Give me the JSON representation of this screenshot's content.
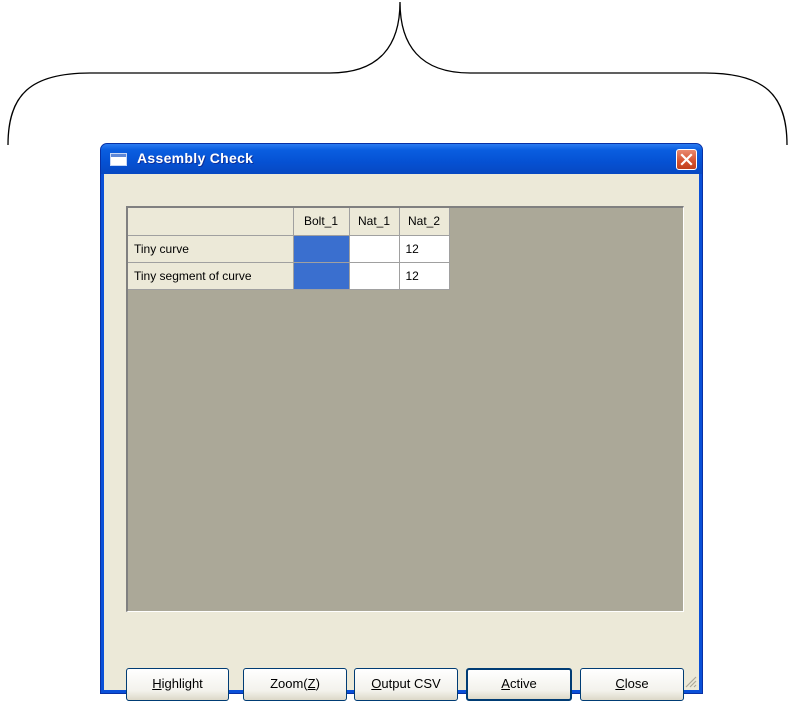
{
  "window": {
    "title": "Assembly Check"
  },
  "grid": {
    "columns": [
      "Bolt_1",
      "Nat_1",
      "Nat_2"
    ],
    "rows": [
      {
        "label": "Tiny curve",
        "cells": [
          "",
          "",
          "12"
        ],
        "bolt_highlighted": true
      },
      {
        "label": "Tiny segment of curve",
        "cells": [
          "",
          "",
          "12"
        ],
        "bolt_highlighted": true
      }
    ]
  },
  "buttons": {
    "highlight": {
      "mnemonic": "H",
      "rest": "ighlight"
    },
    "zoom": {
      "before": "Zoom(",
      "mnemonic": "Z",
      "after": ")"
    },
    "output_csv": {
      "mnemonic": "O",
      "rest": "utput CSV"
    },
    "active": {
      "mnemonic": "A",
      "rest": "ctive"
    },
    "close": {
      "mnemonic": "C",
      "rest": "lose"
    }
  },
  "colors": {
    "titlebar": "#0551d3",
    "highlight_cell": "#3a6fcf",
    "grid_background": "#aba898",
    "dialog_face": "#ece9d8"
  },
  "icons": [
    "window-icon",
    "close-icon",
    "resize-grip-icon",
    "curly-brace-icon"
  ]
}
